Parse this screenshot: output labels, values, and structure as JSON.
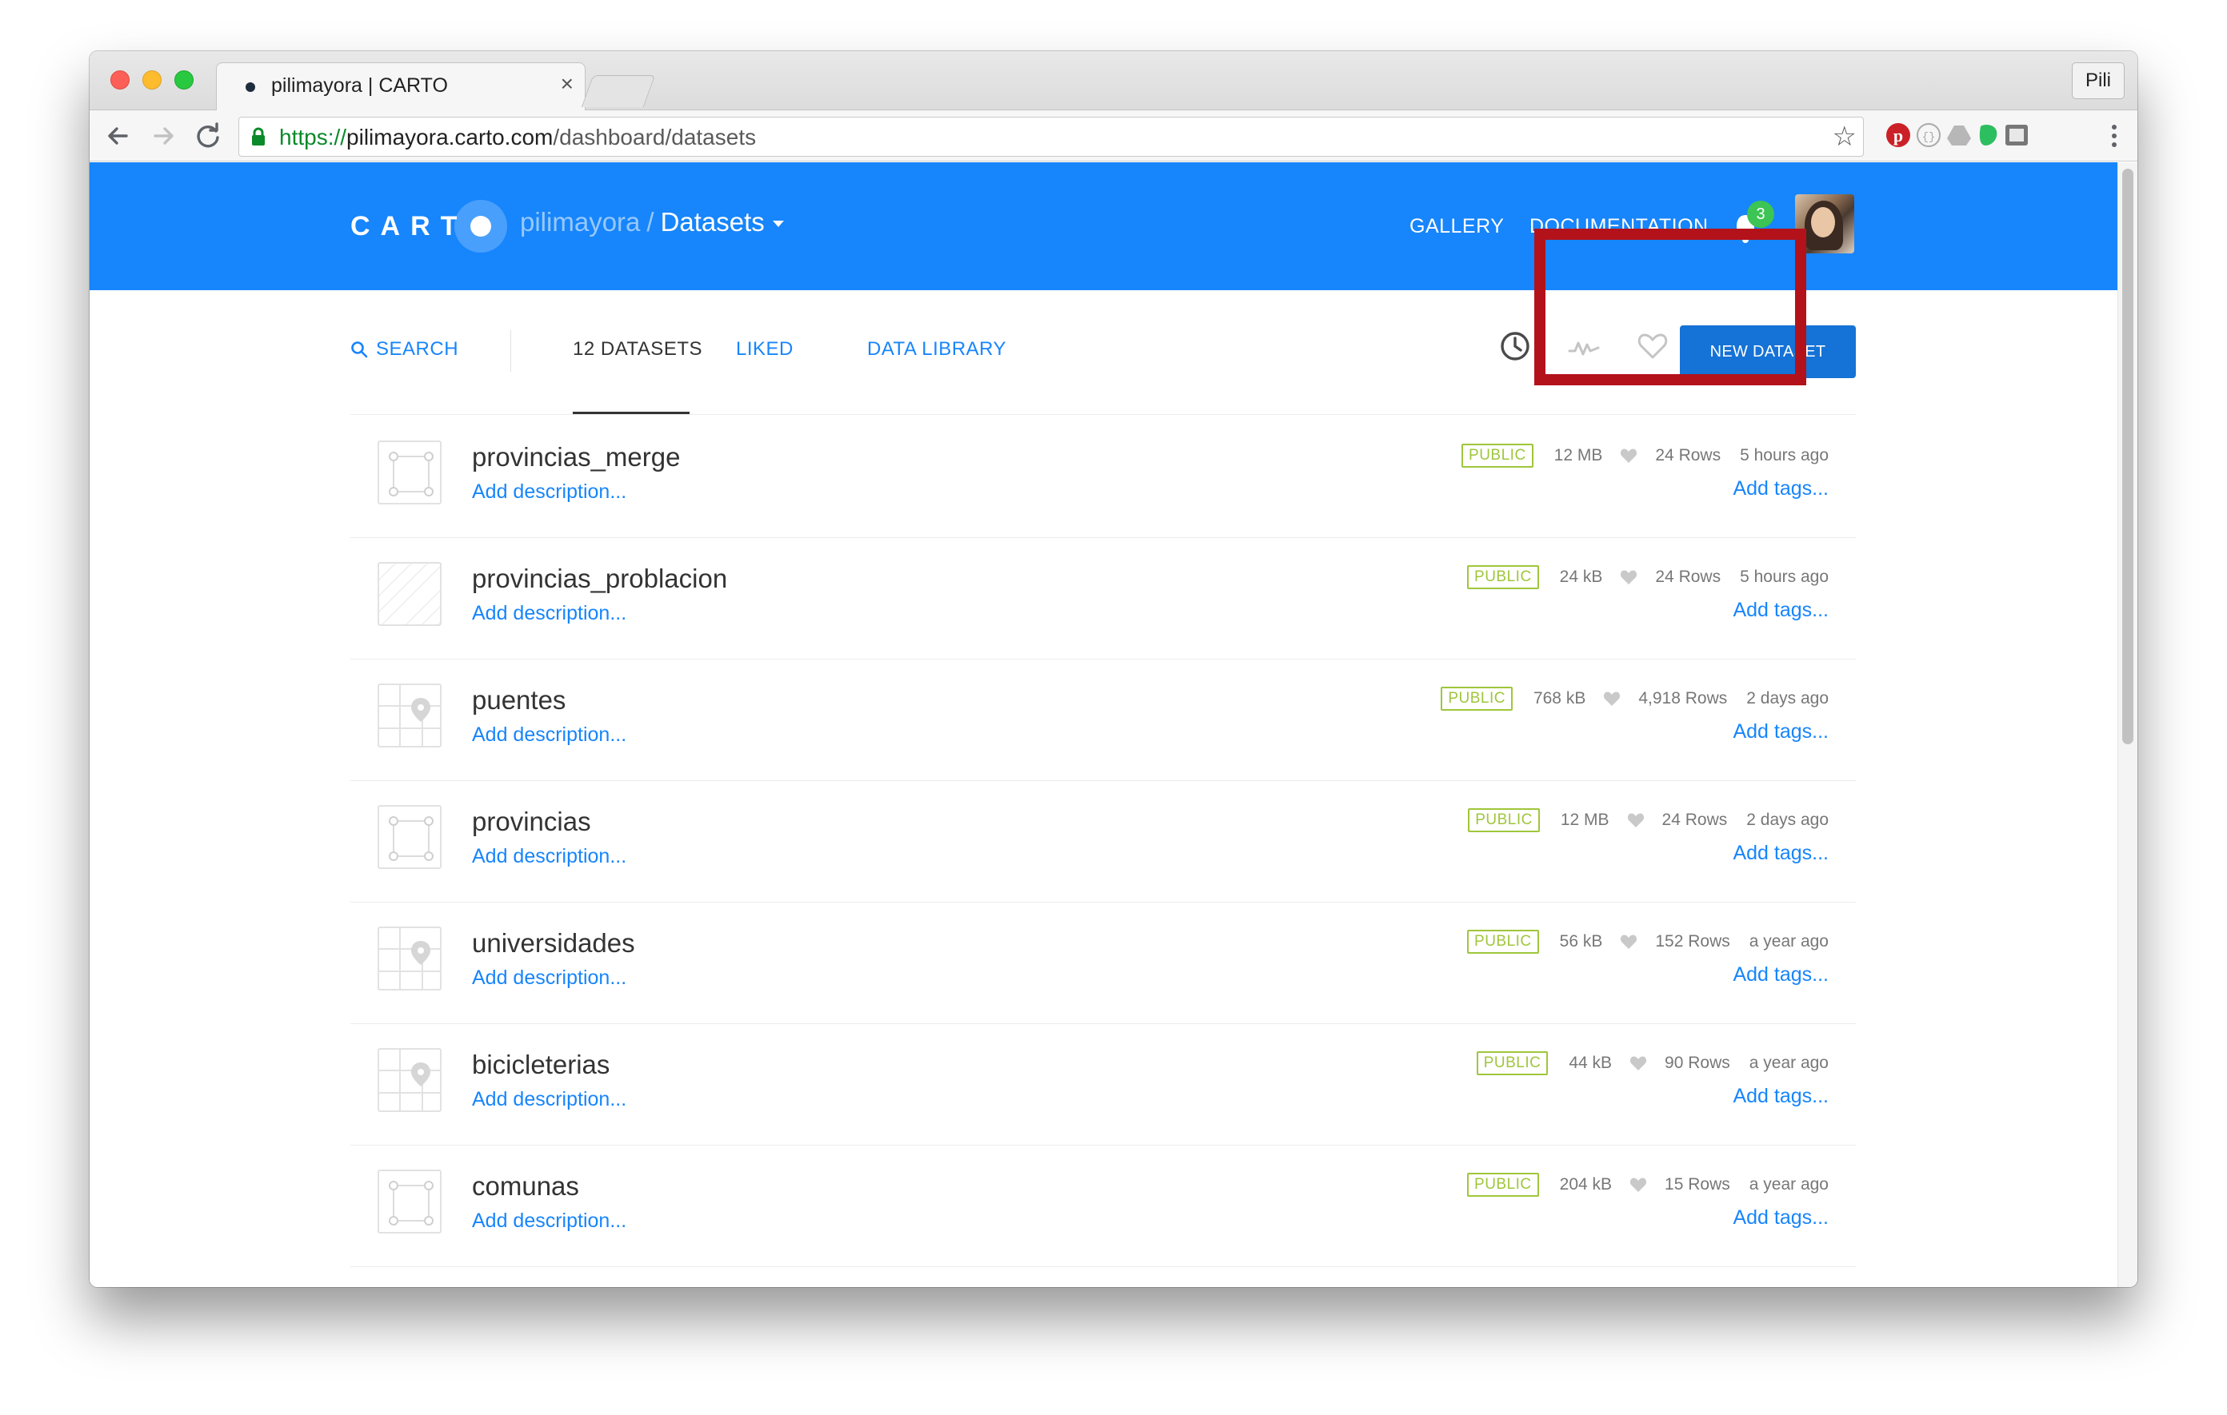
{
  "browser": {
    "tab_title": "pilimayora | CARTO",
    "profile": "Pili",
    "url": {
      "scheme": "https://",
      "host": "pilimayora.carto.com",
      "path": "/dashboard/datasets"
    }
  },
  "header": {
    "logo": "CART",
    "user": "pilimayora",
    "separator": "/",
    "section": "Datasets",
    "links": {
      "gallery": "GALLERY",
      "documentation": "DOCUMENTATION"
    },
    "notification_count": "3"
  },
  "subnav": {
    "search": "SEARCH",
    "tabs": {
      "datasets": "12 DATASETS",
      "liked": "LIKED",
      "data_library": "DATA LIBRARY"
    },
    "new_dataset": "NEW DATASET"
  },
  "colors": {
    "brand": "#1785fb",
    "public_badge": "#9fc63b",
    "highlight": "#b3121b"
  },
  "datasets": [
    {
      "name": "provincias_merge",
      "description": "Add description...",
      "privacy": "PUBLIC",
      "size": "12 MB",
      "rows": "24 Rows",
      "updated": "5 hours ago",
      "tags": "Add tags...",
      "thumb": "polygon"
    },
    {
      "name": "provincias_problacion",
      "description": "Add description...",
      "privacy": "PUBLIC",
      "size": "24 kB",
      "rows": "24 Rows",
      "updated": "5 hours ago",
      "tags": "Add tags...",
      "thumb": "empty"
    },
    {
      "name": "puentes",
      "description": "Add description...",
      "privacy": "PUBLIC",
      "size": "768 kB",
      "rows": "4,918 Rows",
      "updated": "2 days ago",
      "tags": "Add tags...",
      "thumb": "point"
    },
    {
      "name": "provincias",
      "description": "Add description...",
      "privacy": "PUBLIC",
      "size": "12 MB",
      "rows": "24 Rows",
      "updated": "2 days ago",
      "tags": "Add tags...",
      "thumb": "polygon"
    },
    {
      "name": "universidades",
      "description": "Add description...",
      "privacy": "PUBLIC",
      "size": "56 kB",
      "rows": "152 Rows",
      "updated": "a year ago",
      "tags": "Add tags...",
      "thumb": "point"
    },
    {
      "name": "bicicleterias",
      "description": "Add description...",
      "privacy": "PUBLIC",
      "size": "44 kB",
      "rows": "90 Rows",
      "updated": "a year ago",
      "tags": "Add tags...",
      "thumb": "point"
    },
    {
      "name": "comunas",
      "description": "Add description...",
      "privacy": "PUBLIC",
      "size": "204 kB",
      "rows": "15 Rows",
      "updated": "a year ago",
      "tags": "Add tags...",
      "thumb": "polygon"
    }
  ]
}
